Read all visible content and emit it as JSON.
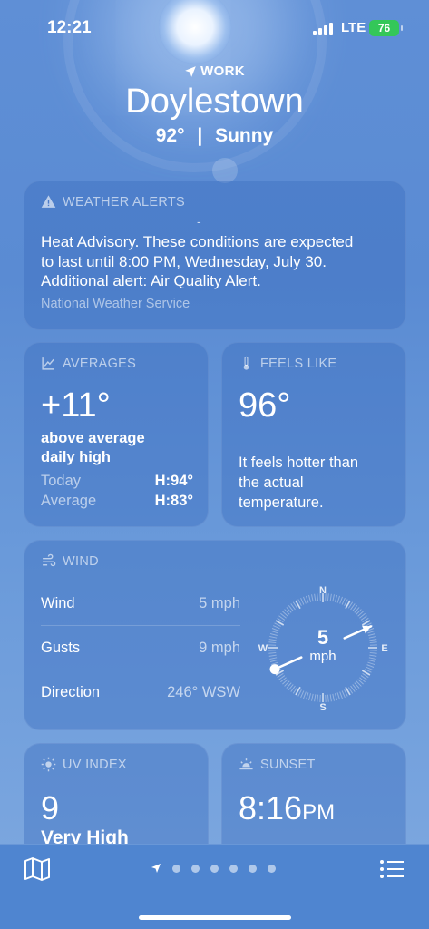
{
  "status_bar": {
    "time": "12:21",
    "network": "LTE",
    "battery": "76"
  },
  "header": {
    "location_label": "WORK",
    "city": "Doylestown",
    "temperature": "92°",
    "separator": "|",
    "condition": "Sunny"
  },
  "alerts": {
    "title": "WEATHER ALERTS",
    "dash": "-",
    "text_line1": "Heat Advisory. These conditions are expected",
    "text_line2": "to last until 8:00 PM, Wednesday, July 30.",
    "text_line3": "Additional alert: Air Quality Alert.",
    "source": "National Weather Service"
  },
  "averages": {
    "title": "AVERAGES",
    "value": "+11°",
    "subtitle_line1": "above average",
    "subtitle_line2": "daily high",
    "today_label": "Today",
    "today_value": "H:94°",
    "average_label": "Average",
    "average_value": "H:83°"
  },
  "feels_like": {
    "title": "FEELS LIKE",
    "value": "96°",
    "desc_line1": "It feels hotter than",
    "desc_line2": "the actual",
    "desc_line3": "temperature."
  },
  "wind": {
    "title": "WIND",
    "rows": [
      {
        "label": "Wind",
        "value": "5 mph"
      },
      {
        "label": "Gusts",
        "value": "9 mph"
      },
      {
        "label": "Direction",
        "value": "246° WSW"
      }
    ],
    "compass": {
      "speed": "5",
      "unit": "mph",
      "n": "N",
      "e": "E",
      "s": "S",
      "w": "W",
      "direction_deg": 246
    }
  },
  "uv": {
    "title": "UV INDEX",
    "value": "9",
    "level": "Very High"
  },
  "sunset": {
    "title": "SUNSET",
    "time": "8:16",
    "ampm": "PM"
  },
  "colors": {
    "battery": "#34c759",
    "card": "#3c6ebe"
  },
  "icons": [
    "location-arrow-icon",
    "warning-icon",
    "chart-icon",
    "thermometer-icon",
    "wind-icon",
    "sun-icon",
    "sunset-icon",
    "map-icon",
    "list-icon"
  ]
}
